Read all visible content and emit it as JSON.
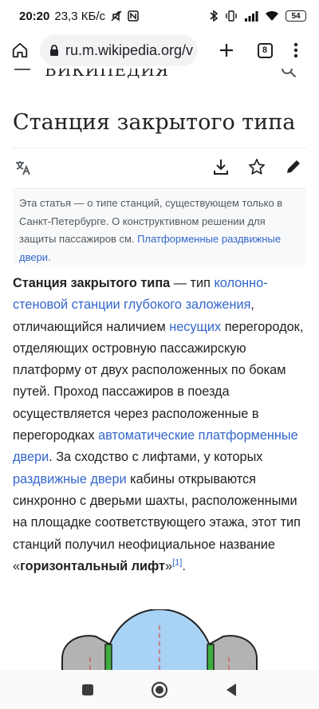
{
  "status_bar": {
    "time": "20:20",
    "net_speed": "23,3 КБ/с",
    "battery": "54",
    "icons": [
      "mute-icon",
      "nfc-icon",
      "bluetooth-icon",
      "vibrate-icon",
      "signal-icon",
      "wifi-icon",
      "battery-icon"
    ]
  },
  "browser": {
    "url": "ru.m.wikipedia.org/v",
    "tab_count": "8",
    "icons": [
      "home-icon",
      "lock-icon",
      "plus-icon",
      "tabs-icon",
      "more-vert-icon"
    ]
  },
  "wiki_header": {
    "wordmark": "ВИКИПЕДИЯ"
  },
  "article": {
    "title": "Станция закрытого типа",
    "actions": [
      "language-icon",
      "download-icon",
      "star-icon",
      "edit-icon"
    ],
    "hatnote": {
      "text_1": "Эта статья — о типе станций, существующем только в Санкт-Петербурге. О конструктивном решении для защиты пассажиров см. ",
      "link": "Платформенные раздвижные двери",
      "text_2": "."
    },
    "lead": {
      "bold_1": "Станция закрытого типа",
      "t1": " — тип ",
      "link_1": "колонно-стеновой станции глубокого заложения",
      "t2": ", отличающийся наличием ",
      "link_2": "несущих",
      "t3": " перегородок, отделяющих островную пассажирскую платформу от двух расположенных по бокам путей. Проход пассажиров в поезда осуществляется через расположенные в перегородках ",
      "link_3": "автоматические платформенные двери",
      "t4": ". За сходство с лифтами, у которых ",
      "link_4": "раздвижные двери",
      "t5": " кабины открываются синхронно с дверьми шахты, расположенными на площадке соответствующего этажа, этот тип станций получил неофициальное название «",
      "bold_2": "горизонтальный лифт",
      "t6": "»",
      "ref": "[1]",
      "t7": "."
    }
  },
  "nav_bar": {
    "icons": [
      "recent-apps-icon",
      "home-circle-icon",
      "back-icon"
    ]
  },
  "colors": {
    "link": "#3366cc",
    "text": "#202122",
    "hatnote_bg": "#f8f9fa",
    "diagram_blue": "#a9d3f5",
    "diagram_gray": "#b3b3b3",
    "diagram_green": "#3fae3f"
  }
}
